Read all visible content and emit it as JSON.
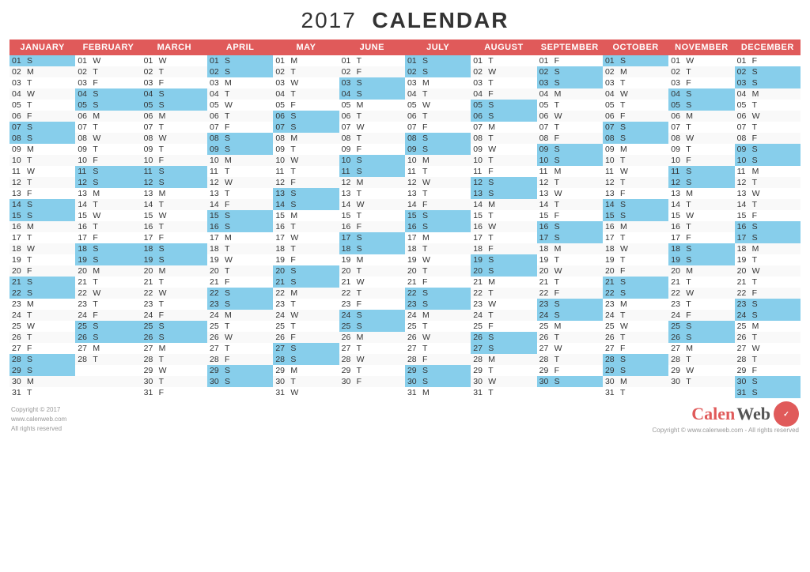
{
  "title": "2017 CALENDAR",
  "year": "2017",
  "calendarLabel": "CALENDAR",
  "months": [
    "JANUARY",
    "FEBRUARY",
    "MARCH",
    "APRIL",
    "MAY",
    "JUNE",
    "JULY",
    "AUGUST",
    "SEPTEMBER",
    "OCTOBER",
    "NOVEMBER",
    "DECEMBER"
  ],
  "accentColor": "#e05a5a",
  "highlightColor": "#87CEEB",
  "copyright": {
    "left1": "Copyright © 2017",
    "left2": "www.calenweb.com",
    "left3": "All rights reserved",
    "bottom": "Copyright © www.calenweb.com - All rights reserved"
  },
  "brand": "CalenWeb"
}
